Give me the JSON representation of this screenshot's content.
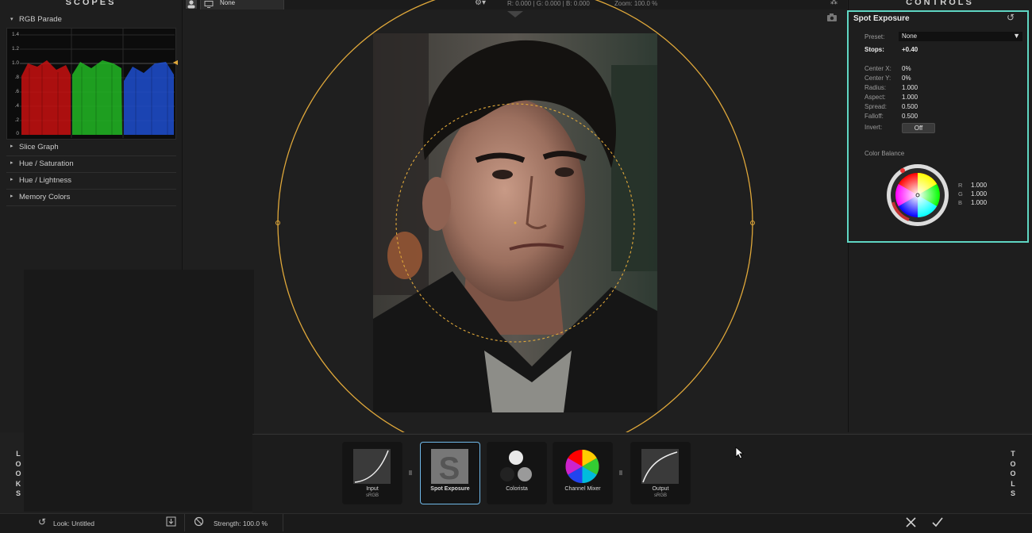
{
  "scopes": {
    "title": "SCOPES",
    "parade_label": "RGB Parade",
    "axis": [
      "1.4",
      "1.2",
      "1.0",
      ".8",
      ".6",
      ".4",
      ".2",
      "0"
    ],
    "sections": [
      "Slice Graph",
      "Hue / Saturation",
      "Hue / Lightness",
      "Memory Colors"
    ]
  },
  "viewer": {
    "compare": "None",
    "readout": "R: 0.000 | G: 0.000 | B: 0.000",
    "zoom": "Zoom: 100.0 %"
  },
  "controls": {
    "title": "CONTROLS",
    "panel_title": "Spot Exposure",
    "preset_label": "Preset:",
    "preset_value": "None",
    "stops_label": "Stops:",
    "stops_value": "+0.40",
    "params": [
      {
        "label": "Center X:",
        "value": "0%"
      },
      {
        "label": "Center Y:",
        "value": "0%"
      },
      {
        "label": "Radius:",
        "value": "1.000"
      },
      {
        "label": "Aspect:",
        "value": "1.000"
      },
      {
        "label": "Spread:",
        "value": "0.500"
      },
      {
        "label": "Falloff:",
        "value": "0.500"
      }
    ],
    "invert_label": "Invert:",
    "invert_value": "Off",
    "color_balance_label": "Color Balance",
    "rgb": [
      {
        "label": "R",
        "value": "1.000"
      },
      {
        "label": "G",
        "value": "1.000"
      },
      {
        "label": "B",
        "value": "1.000"
      }
    ]
  },
  "tools": {
    "nodes": [
      {
        "label": "Input",
        "sub": "sRGB"
      },
      {
        "label": "Spot Exposure",
        "sub": ""
      },
      {
        "label": "Colorista",
        "sub": ""
      },
      {
        "label": "Channel Mixer",
        "sub": ""
      },
      {
        "label": "Output",
        "sub": "sRGB"
      }
    ],
    "looks_vertical": [
      "L",
      "O",
      "O",
      "K",
      "S"
    ],
    "tools_vertical": [
      "T",
      "O",
      "O",
      "L",
      "S"
    ]
  },
  "status": {
    "look": "Look:  Untitled",
    "strength": "Strength: 100.0 %"
  },
  "colors": {
    "accent": "#5fd6c3",
    "overlay_circle": "#e0a83a"
  }
}
